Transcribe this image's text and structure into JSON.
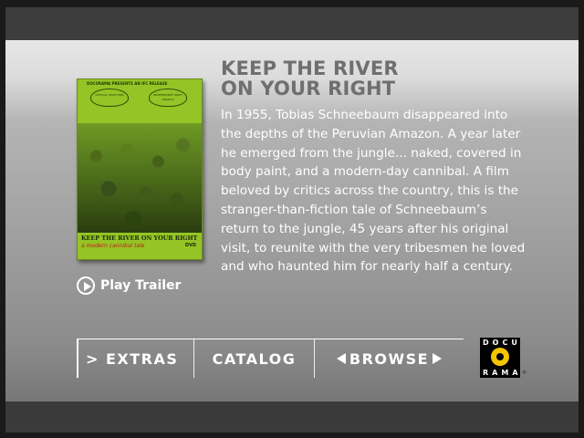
{
  "title": [
    "KEEP THE RIVER",
    "ON YOUR RIGHT"
  ],
  "description": "In 1955, Tobias Schneebaum disappeared into the depths of the Peruvian Amazon. A year later he emerged from the jungle... naked, covered in body paint, and a modern-day cannibal. A film beloved by critics across the country, this is the stranger-than-fiction tale of Schneebaum’s return to the jungle, 45 years after his original visit, to reunite with the very tribesmen he loved and who haunted him for nearly half a century.",
  "cover": {
    "presents": "DOCURAMA PRESENTS AN IFC RELEASE",
    "laurel_left": "OFFICIAL SELECTION",
    "laurel_right": "INDEPENDENT SPIRIT AWARDS",
    "title": "KEEP THE RIVER ON YOUR RIGHT",
    "subtitle": "a modern cannibal tale",
    "format": "DVD"
  },
  "play_trailer": "Play Trailer",
  "nav": {
    "extras": "> EXTRAS",
    "catalog": "CATALOG",
    "browse": "BROWSE"
  },
  "logo": {
    "top": "DOCU",
    "bottom": "RAMA",
    "tm": "®"
  },
  "colors": {
    "title": "#6f6f6f",
    "text": "#ffffff",
    "cover_green": "#94c425",
    "logo_yellow": "#f4c400"
  }
}
